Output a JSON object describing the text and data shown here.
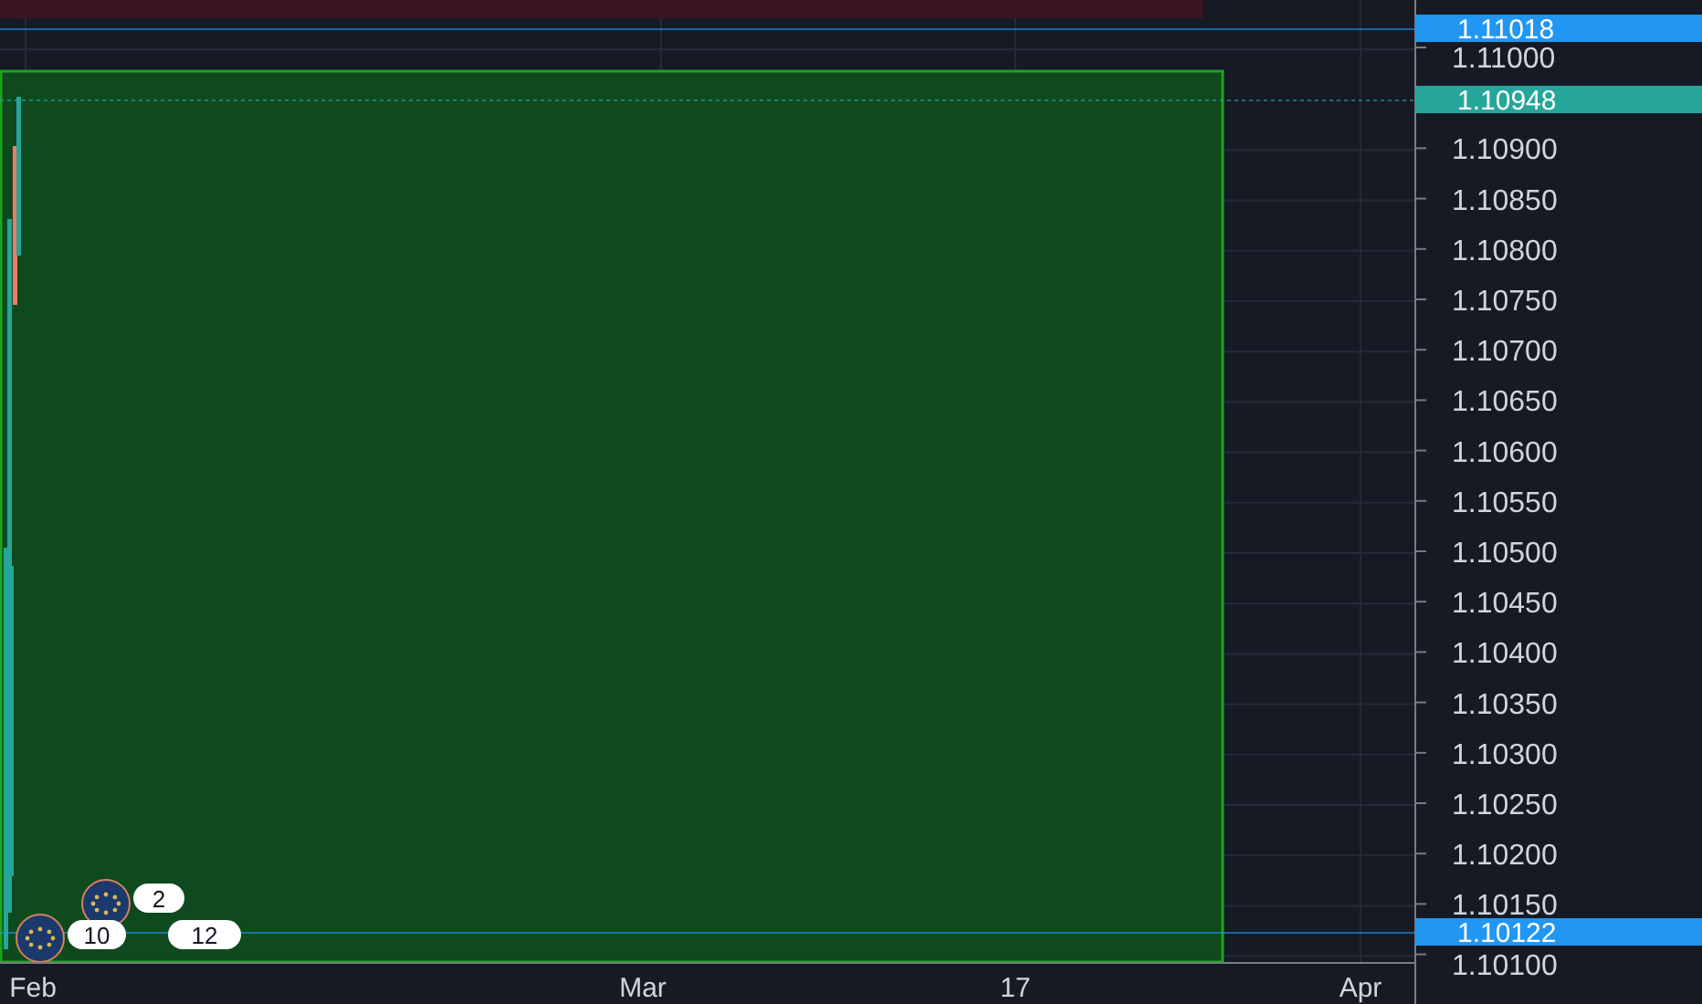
{
  "price_axis": {
    "ticks": [
      "1.11000",
      "1.10900",
      "1.10850",
      "1.10800",
      "1.10750",
      "1.10700",
      "1.10650",
      "1.10600",
      "1.10550",
      "1.10500",
      "1.10450",
      "1.10400",
      "1.10350",
      "1.10300",
      "1.10250",
      "1.10200",
      "1.10150",
      "1.10100"
    ]
  },
  "price_tags": [
    {
      "label": "1.11018",
      "color": "#2196f3"
    },
    {
      "label": "1.10948",
      "color": "#26a69a"
    },
    {
      "label": "1.10122",
      "color": "#2196f3"
    }
  ],
  "time_axis": [
    "Feb",
    "Mar",
    "17",
    "Apr"
  ],
  "events": [
    {
      "count": "2"
    },
    {
      "count": "10"
    },
    {
      "count": "12"
    }
  ]
}
